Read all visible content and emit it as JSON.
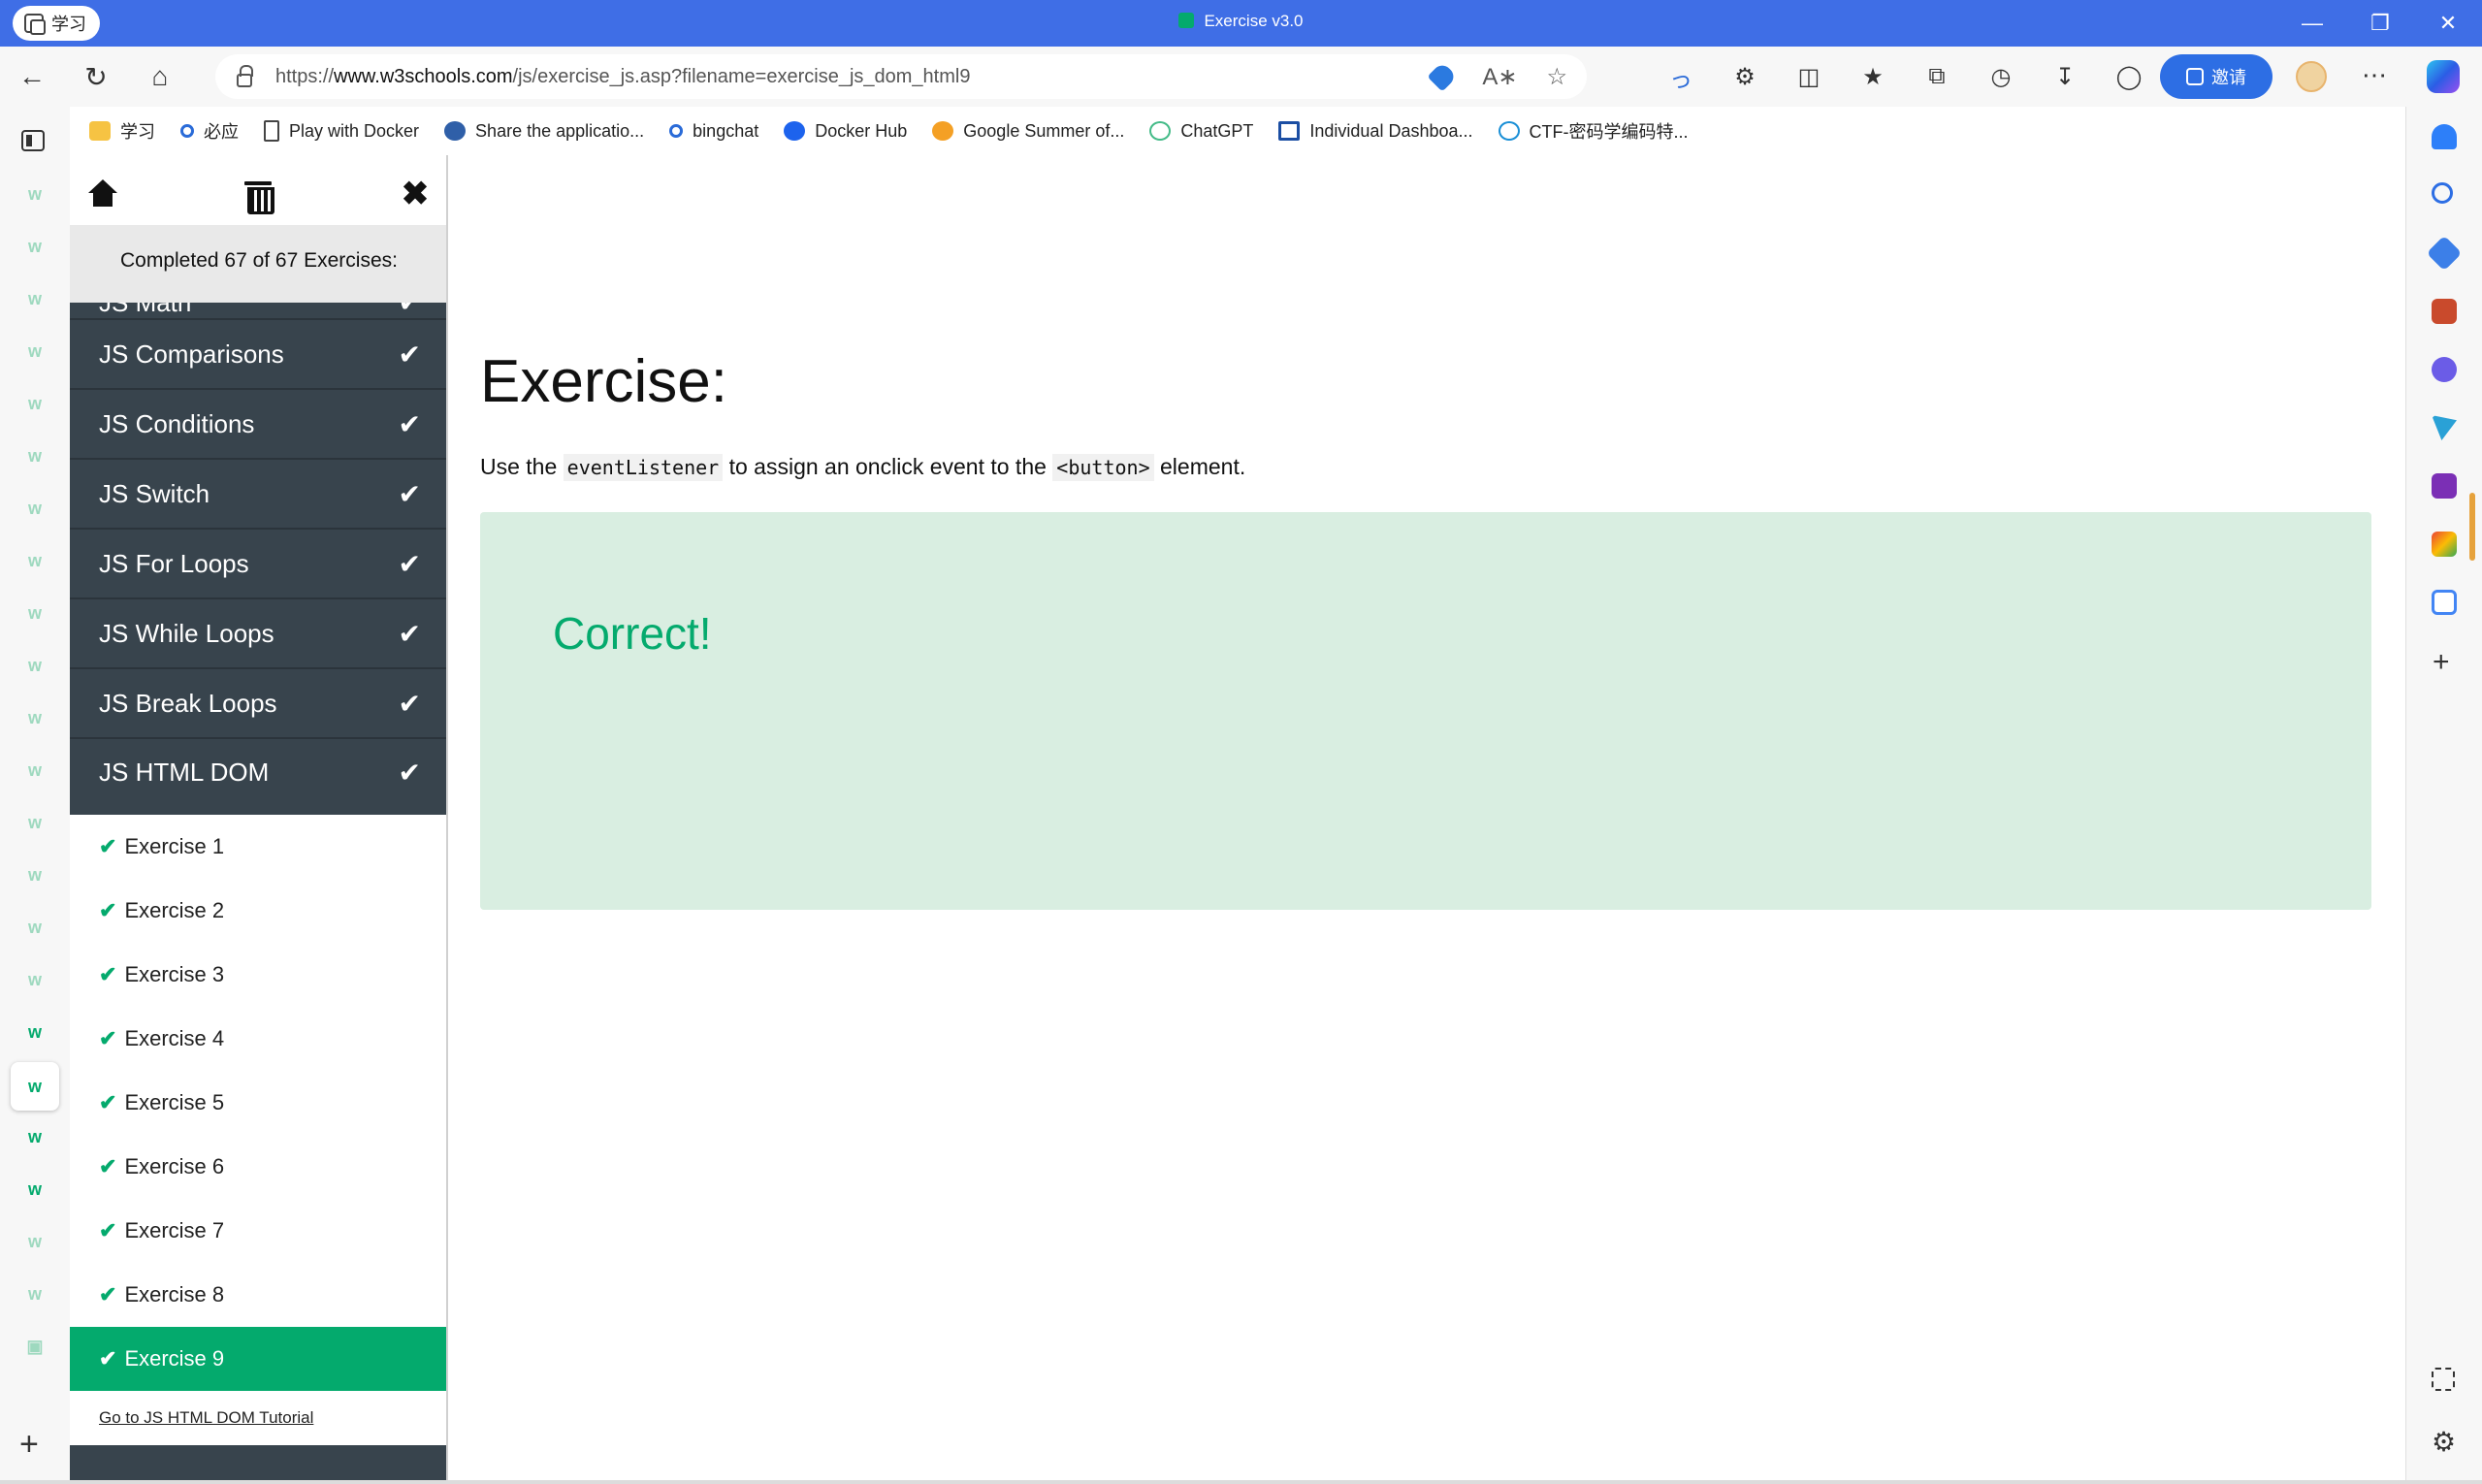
{
  "browser": {
    "profile_label": "学习",
    "window_title": "Exercise v3.0",
    "url_prefix": "https://",
    "url_domain": "www.w3schools.com",
    "url_path": "/js/exercise_js.asp?filename=exercise_js_dom_html9",
    "invite_label": "邀请",
    "bookmarks": [
      {
        "label": "学习",
        "icon": "folder-icon"
      },
      {
        "label": "必应",
        "icon": "search-icon"
      },
      {
        "label": "Play with Docker",
        "icon": "page-icon"
      },
      {
        "label": "Share the applicatio...",
        "icon": "globe-icon"
      },
      {
        "label": "bingchat",
        "icon": "search-icon"
      },
      {
        "label": "Docker Hub",
        "icon": "docker-icon"
      },
      {
        "label": "Google Summer of...",
        "icon": "sun-icon"
      },
      {
        "label": "ChatGPT",
        "icon": "chatgpt-icon"
      },
      {
        "label": "Individual Dashboa...",
        "icon": "dashboard-icon"
      },
      {
        "label": "CTF-密码学编码特...",
        "icon": "cloud-icon"
      }
    ],
    "accent_color": "#3f6ee6"
  },
  "panel": {
    "status": "Completed 67 of 67 Exercises:",
    "topics": [
      {
        "label": "JS Math"
      },
      {
        "label": "JS Comparisons"
      },
      {
        "label": "JS Conditions"
      },
      {
        "label": "JS Switch"
      },
      {
        "label": "JS For Loops"
      },
      {
        "label": "JS While Loops"
      },
      {
        "label": "JS Break Loops"
      },
      {
        "label": "JS HTML DOM"
      }
    ],
    "exercises": [
      {
        "label": "Exercise 1"
      },
      {
        "label": "Exercise 2"
      },
      {
        "label": "Exercise 3"
      },
      {
        "label": "Exercise 4"
      },
      {
        "label": "Exercise 5"
      },
      {
        "label": "Exercise 6"
      },
      {
        "label": "Exercise 7"
      },
      {
        "label": "Exercise 8"
      },
      {
        "label": "Exercise 9"
      }
    ],
    "selected_exercise": "Exercise 9",
    "tutorial_link": "Go to JS HTML DOM Tutorial",
    "check_glyph": "✔",
    "dark_color": "#38444d",
    "green_color": "#04aa6d"
  },
  "main": {
    "title": "Exercise:",
    "instruction": {
      "part1": "Use the ",
      "code1": "eventListener",
      "part2": " to assign an onclick event to the ",
      "code2": "<button>",
      "part3": " element."
    },
    "result": "Correct!",
    "result_bg_color": "#d9eee1"
  }
}
